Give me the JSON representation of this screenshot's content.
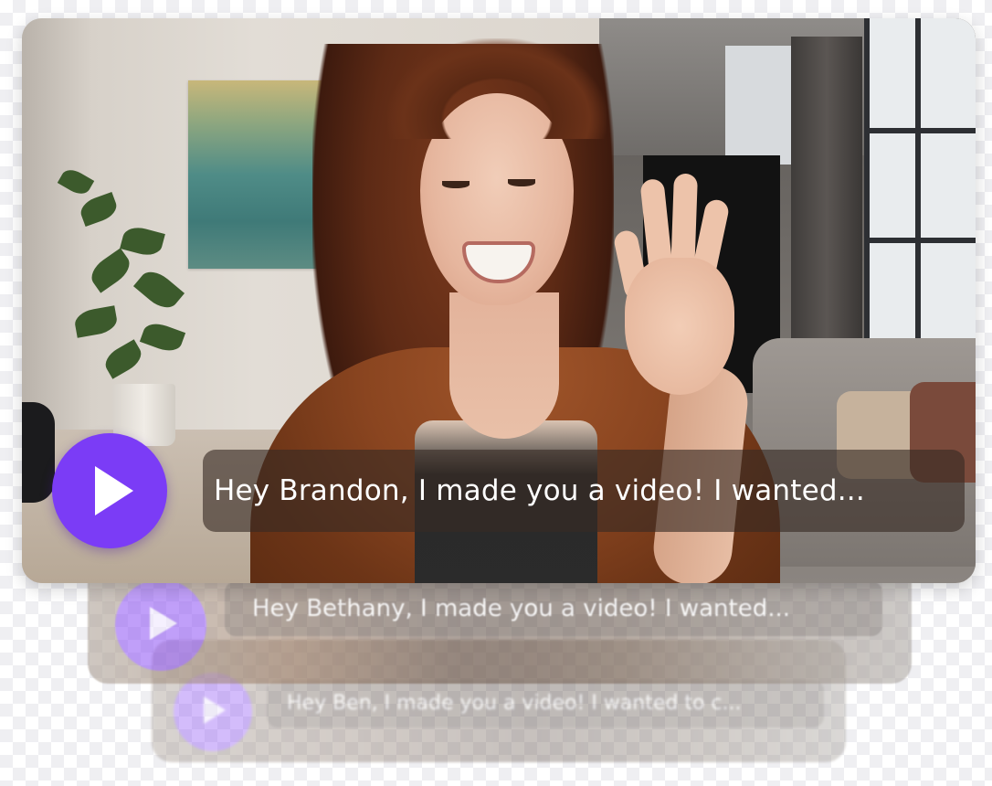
{
  "cards": [
    {
      "id": "front",
      "caption": "Hey Brandon, I made you a video! I wanted...",
      "play_icon": "play-icon"
    },
    {
      "id": "back-1",
      "caption": "Hey Bethany, I made you a video! I wanted...",
      "play_icon": "play-icon"
    },
    {
      "id": "back-2",
      "caption": "Hey Ben, I made you a video! I wanted to c...",
      "play_icon": "play-icon"
    }
  ],
  "colors": {
    "play_button": "#7b3cf6",
    "caption_bg": "#372a24",
    "caption_text": "#ffffff"
  }
}
